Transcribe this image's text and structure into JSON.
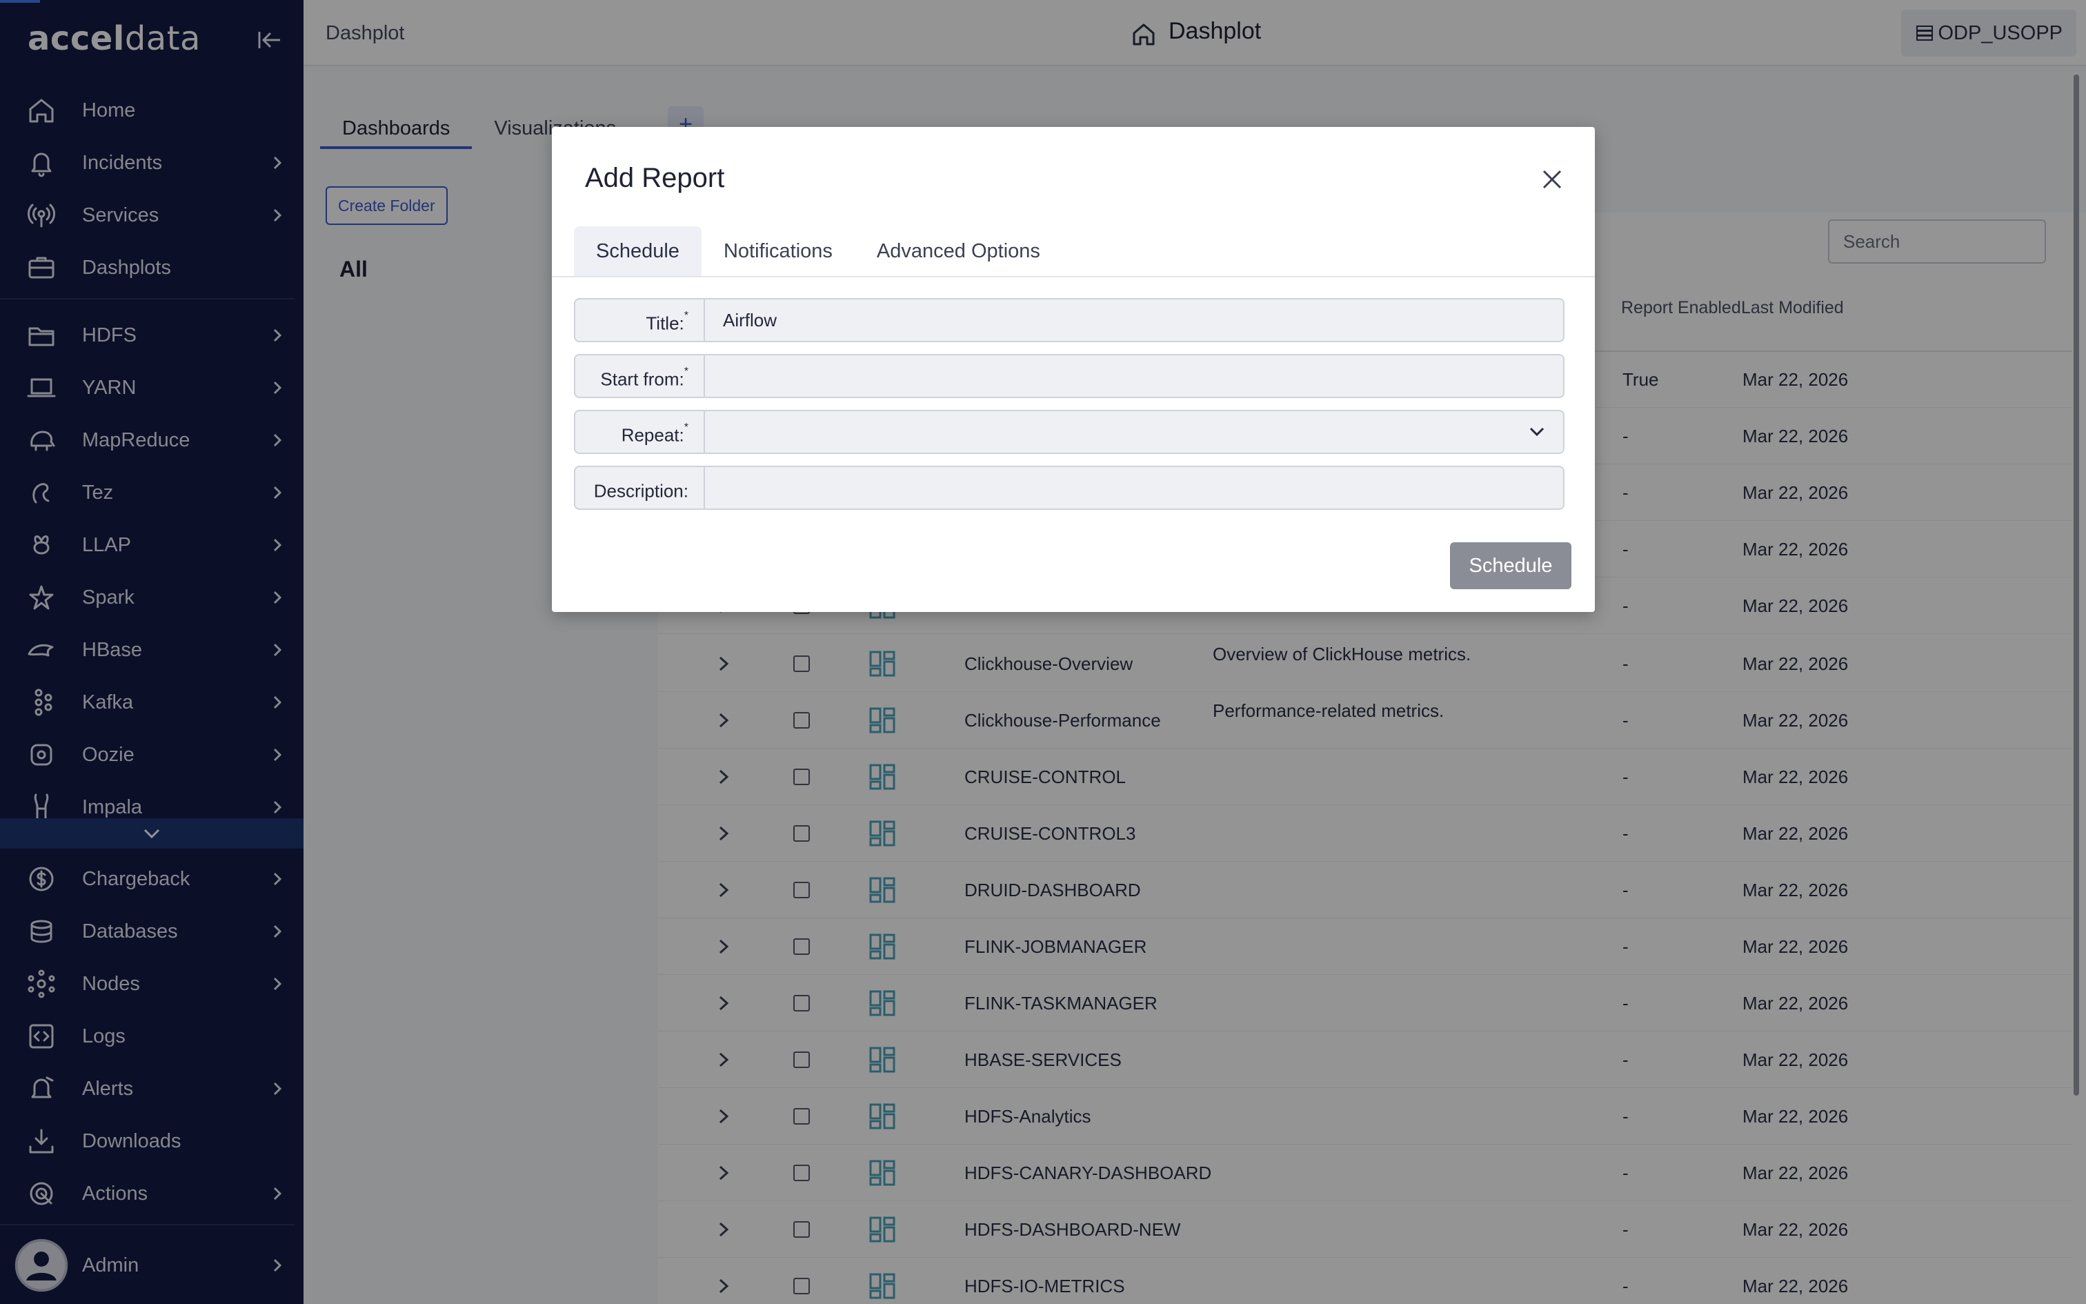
{
  "app": {
    "brand_bold": "accel",
    "brand_light": "data"
  },
  "sidebar": {
    "items": [
      {
        "label": "Home",
        "icon": "home-icon",
        "expandable": false
      },
      {
        "label": "Incidents",
        "icon": "bell-icon",
        "expandable": true
      },
      {
        "label": "Services",
        "icon": "broadcast-icon",
        "expandable": true
      },
      {
        "label": "Dashplots",
        "icon": "briefcase-icon",
        "expandable": false
      },
      {
        "label": "HDFS",
        "icon": "folder-icon",
        "expandable": true
      },
      {
        "label": "YARN",
        "icon": "laptop-icon",
        "expandable": true
      },
      {
        "label": "MapReduce",
        "icon": "elephant-icon",
        "expandable": true
      },
      {
        "label": "Tez",
        "icon": "tez-icon",
        "expandable": true
      },
      {
        "label": "LLAP",
        "icon": "bee-icon",
        "expandable": true
      },
      {
        "label": "Spark",
        "icon": "spark-icon",
        "expandable": true
      },
      {
        "label": "HBase",
        "icon": "orca-icon",
        "expandable": true
      },
      {
        "label": "Kafka",
        "icon": "kafka-icon",
        "expandable": true
      },
      {
        "label": "Oozie",
        "icon": "oozie-icon",
        "expandable": true
      },
      {
        "label": "Impala",
        "icon": "antelope-icon",
        "expandable": true
      },
      {
        "label": "Chargeback",
        "icon": "dollar-icon",
        "expandable": true
      },
      {
        "label": "Databases",
        "icon": "database-icon",
        "expandable": true
      },
      {
        "label": "Nodes",
        "icon": "nodes-icon",
        "expandable": true
      },
      {
        "label": "Logs",
        "icon": "code-icon",
        "expandable": false
      },
      {
        "label": "Alerts",
        "icon": "alert-bell-icon",
        "expandable": true
      },
      {
        "label": "Downloads",
        "icon": "download-icon",
        "expandable": false
      },
      {
        "label": "Actions",
        "icon": "target-icon",
        "expandable": true
      },
      {
        "label": "Admin",
        "icon": "avatar-icon",
        "expandable": true
      }
    ]
  },
  "header": {
    "breadcrumb": "Dashplot",
    "title": "Dashplot",
    "cluster": "ODP_USOPP"
  },
  "main": {
    "tabs": [
      "Dashboards",
      "Visualizations"
    ],
    "add_tab": "+",
    "create_folder": "Create Folder",
    "folder_all": "All",
    "search_placeholder": "Search",
    "columns": {
      "report_enabled": "Report Enabled",
      "last_modified": "Last Modified"
    },
    "rows": [
      {
        "name": "",
        "description": "",
        "enabled": "True",
        "modified": "Mar 22, 2026"
      },
      {
        "name": "",
        "description": "",
        "enabled": "-",
        "modified": "Mar 22, 2026"
      },
      {
        "name": "",
        "description": "",
        "enabled": "-",
        "modified": "Mar 22, 2026"
      },
      {
        "name": "",
        "description": "",
        "enabled": "-",
        "modified": "Mar 22, 2026"
      },
      {
        "name": "",
        "description": "",
        "enabled": "-",
        "modified": "Mar 22, 2026"
      },
      {
        "name": "Clickhouse-Overview",
        "description": "Overview of ClickHouse metrics.",
        "enabled": "-",
        "modified": "Mar 22, 2026"
      },
      {
        "name": "Clickhouse-Performance",
        "description": "Performance-related metrics.",
        "enabled": "-",
        "modified": "Mar 22, 2026"
      },
      {
        "name": "CRUISE-CONTROL",
        "description": "",
        "enabled": "-",
        "modified": "Mar 22, 2026"
      },
      {
        "name": "CRUISE-CONTROL3",
        "description": "",
        "enabled": "-",
        "modified": "Mar 22, 2026"
      },
      {
        "name": "DRUID-DASHBOARD",
        "description": "",
        "enabled": "-",
        "modified": "Mar 22, 2026"
      },
      {
        "name": "FLINK-JOBMANAGER",
        "description": "",
        "enabled": "-",
        "modified": "Mar 22, 2026"
      },
      {
        "name": "FLINK-TASKMANAGER",
        "description": "",
        "enabled": "-",
        "modified": "Mar 22, 2026"
      },
      {
        "name": "HBASE-SERVICES",
        "description": "",
        "enabled": "-",
        "modified": "Mar 22, 2026"
      },
      {
        "name": "HDFS-Analytics",
        "description": "",
        "enabled": "-",
        "modified": "Mar 22, 2026"
      },
      {
        "name": "HDFS-CANARY-DASHBOARD",
        "description": "",
        "enabled": "-",
        "modified": "Mar 22, 2026"
      },
      {
        "name": "HDFS-DASHBOARD-NEW",
        "description": "",
        "enabled": "-",
        "modified": "Mar 22, 2026"
      },
      {
        "name": "HDFS-IO-METRICS",
        "description": "",
        "enabled": "-",
        "modified": "Mar 22, 2026"
      }
    ]
  },
  "modal": {
    "title": "Add Report",
    "tabs": [
      "Schedule",
      "Notifications",
      "Advanced Options"
    ],
    "fields": [
      {
        "label": "Title:",
        "required": "*",
        "value": "Airflow",
        "type": "text"
      },
      {
        "label": "Start from:",
        "required": "*",
        "value": "",
        "type": "text"
      },
      {
        "label": "Repeat:",
        "required": "*",
        "value": "",
        "type": "select"
      },
      {
        "label": "Description:",
        "required": "",
        "value": "",
        "type": "text"
      }
    ],
    "submit": "Schedule"
  },
  "colors": {
    "sidebar_bg": "#141a45",
    "accent": "#3b5bd0",
    "dashboard_icon": "#4aa3b8",
    "submit_disabled": "#8a8d96"
  }
}
